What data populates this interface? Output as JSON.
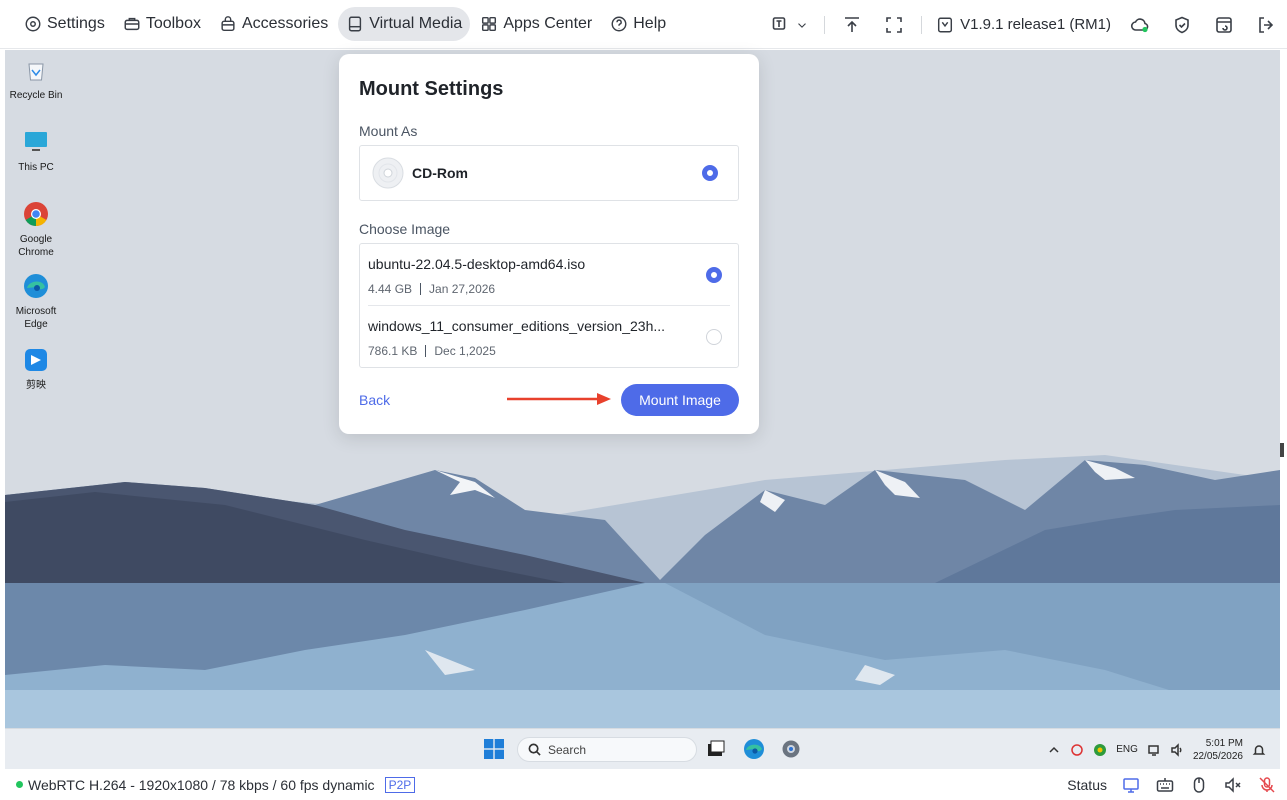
{
  "nav": {
    "items": [
      {
        "label": "Settings",
        "icon": "gear-icon"
      },
      {
        "label": "Toolbox",
        "icon": "toolbox-icon"
      },
      {
        "label": "Accessories",
        "icon": "bag-icon"
      },
      {
        "label": "Virtual Media",
        "icon": "drive-icon",
        "active": true
      },
      {
        "label": "Apps Center",
        "icon": "grid-icon"
      },
      {
        "label": "Help",
        "icon": "help-icon"
      }
    ]
  },
  "toolbar": {
    "version": "V1.9.1 release1 (RM1)"
  },
  "desktop": {
    "icons": [
      {
        "label": "Recycle Bin"
      },
      {
        "label": "This PC"
      },
      {
        "label": "Google Chrome"
      },
      {
        "label": "Microsoft Edge"
      },
      {
        "label": "剪映"
      }
    ]
  },
  "taskbar": {
    "search_placeholder": "Search",
    "lang": "ENG",
    "time": "5:01 PM",
    "date": "22/05/2026"
  },
  "modal": {
    "title": "Mount Settings",
    "mount_as_label": "Mount As",
    "mount_option": "CD-Rom",
    "choose_image_label": "Choose Image",
    "images": [
      {
        "name": "ubuntu-22.04.5-desktop-amd64.iso",
        "size": "4.44 GB",
        "date": "Jan 27,2026",
        "selected": true
      },
      {
        "name": "windows_11_consumer_editions_version_23h...",
        "size": "786.1 KB",
        "date": "Dec 1,2025",
        "selected": false
      }
    ],
    "back_label": "Back",
    "mount_button": "Mount Image"
  },
  "status": {
    "connection": "WebRTC H.264 - 1920x1080 / 78 kbps / 60 fps dynamic",
    "badge": "P2P",
    "status_label": "Status"
  },
  "colors": {
    "accent": "#4e6be8",
    "annotation_arrow": "#e8412c",
    "online": "#22c55e"
  }
}
